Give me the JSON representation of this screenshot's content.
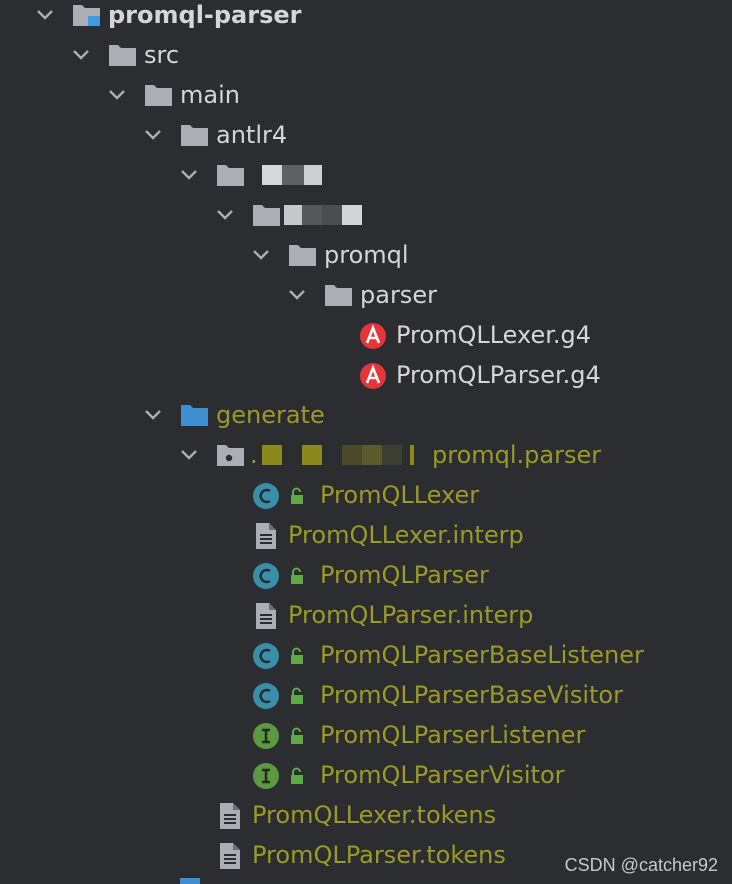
{
  "tree": {
    "root": "promql-parser",
    "src": "src",
    "main": "main",
    "antlr4": "antlr4",
    "promql": "promql",
    "parser": "parser",
    "lexer_g4": "PromQLLexer.g4",
    "parser_g4": "PromQLParser.g4",
    "generate": "generate",
    "package_suffix": "promql.parser",
    "package_prefix": ".",
    "files": [
      {
        "label": "PromQLLexer",
        "kind": "class"
      },
      {
        "label": "PromQLLexer.interp",
        "kind": "text"
      },
      {
        "label": "PromQLParser",
        "kind": "class"
      },
      {
        "label": "PromQLParser.interp",
        "kind": "text"
      },
      {
        "label": "PromQLParserBaseListener",
        "kind": "class"
      },
      {
        "label": "PromQLParserBaseVisitor",
        "kind": "class"
      },
      {
        "label": "PromQLParserListener",
        "kind": "interface"
      },
      {
        "label": "PromQLParserVisitor",
        "kind": "interface"
      }
    ],
    "tokens": [
      "PromQLLexer.tokens",
      "PromQLParser.tokens"
    ]
  },
  "colors": {
    "background": "#2b2d30",
    "text": "#d4d6da",
    "generated_text": "#9a9a27",
    "folder": "#a9afb5",
    "source_folder": "#3d8fd1",
    "class_badge": "#3a8ea8",
    "interface_badge": "#5b9a42",
    "antlr_badge": "#e5343a",
    "lock": "#5faa48"
  },
  "icons": {
    "chevron": "chevron-down-icon",
    "folder": "folder-icon",
    "package": "package-icon",
    "class": "class-icon",
    "interface": "interface-icon",
    "antlr": "antlr-icon",
    "text_file": "text-file-icon",
    "lock": "lock-icon"
  },
  "watermark": "CSDN @catcher92"
}
